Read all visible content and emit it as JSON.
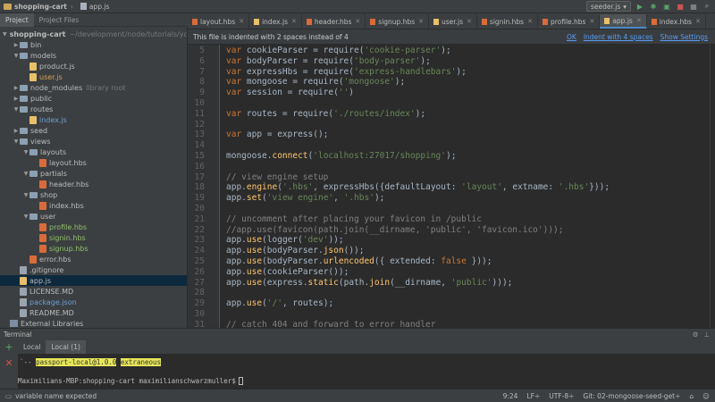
{
  "navbar": {
    "project": "shopping-cart",
    "file": "app.js",
    "run_config": "seeder.js"
  },
  "project_panel": {
    "tabs": [
      "Project",
      "Project Files"
    ],
    "tree": [
      {
        "label": "shopping-cart",
        "suffix": "~/development/node/tutorials/you",
        "indent": 0,
        "type": "folder",
        "expanded": true
      },
      {
        "label": "bin",
        "indent": 1,
        "type": "folder",
        "expanded": false
      },
      {
        "label": "models",
        "indent": 1,
        "type": "folder",
        "expanded": true
      },
      {
        "label": "product.js",
        "indent": 2,
        "type": "js"
      },
      {
        "label": "user.js",
        "indent": 2,
        "type": "js",
        "color": "orange"
      },
      {
        "label": "node_modules",
        "suffix": "library root",
        "indent": 1,
        "type": "folder",
        "expanded": false
      },
      {
        "label": "public",
        "indent": 1,
        "type": "folder",
        "expanded": false
      },
      {
        "label": "routes",
        "indent": 1,
        "type": "folder",
        "expanded": true
      },
      {
        "label": "index.js",
        "indent": 2,
        "type": "js",
        "color": "blue"
      },
      {
        "label": "seed",
        "indent": 1,
        "type": "folder",
        "expanded": false
      },
      {
        "label": "views",
        "indent": 1,
        "type": "folder",
        "expanded": true
      },
      {
        "label": "layouts",
        "indent": 2,
        "type": "folder",
        "expanded": true
      },
      {
        "label": "layout.hbs",
        "indent": 3,
        "type": "hbs"
      },
      {
        "label": "partials",
        "indent": 2,
        "type": "folder",
        "expanded": true
      },
      {
        "label": "header.hbs",
        "indent": 3,
        "type": "hbs"
      },
      {
        "label": "shop",
        "indent": 2,
        "type": "folder",
        "expanded": true
      },
      {
        "label": "index.hbs",
        "indent": 3,
        "type": "hbs"
      },
      {
        "label": "user",
        "indent": 2,
        "type": "folder",
        "expanded": true
      },
      {
        "label": "profile.hbs",
        "indent": 3,
        "type": "hbs",
        "color": "green"
      },
      {
        "label": "signin.hbs",
        "indent": 3,
        "type": "hbs",
        "color": "green"
      },
      {
        "label": "signup.hbs",
        "indent": 3,
        "type": "hbs",
        "color": "green"
      },
      {
        "label": "error.hbs",
        "indent": 2,
        "type": "hbs"
      },
      {
        "label": ".gitignore",
        "indent": 1,
        "type": "txt"
      },
      {
        "label": "app.js",
        "indent": 1,
        "type": "js",
        "selected": true
      },
      {
        "label": "LICENSE.MD",
        "indent": 1,
        "type": "txt"
      },
      {
        "label": "package.json",
        "indent": 1,
        "type": "txt",
        "color": "blue"
      },
      {
        "label": "README.MD",
        "indent": 1,
        "type": "txt"
      },
      {
        "label": "External Libraries",
        "indent": 0,
        "type": "lib"
      }
    ]
  },
  "tabs": [
    {
      "label": "layout.hbs"
    },
    {
      "label": "index.js"
    },
    {
      "label": "header.hbs"
    },
    {
      "label": "signup.hbs"
    },
    {
      "label": "user.js"
    },
    {
      "label": "signin.hbs"
    },
    {
      "label": "profile.hbs"
    },
    {
      "label": "app.js",
      "active": true
    },
    {
      "label": "index.hbs"
    }
  ],
  "banner": {
    "message": "This file is indented with 2 spaces instead of 4",
    "ok": "OK",
    "indent4": "Indent with 4 spaces",
    "settings": "Show Settings"
  },
  "editor": {
    "lines": [
      {
        "n": "5",
        "html": "<span class='kw'>var</span> cookieParser = require(<span class='str'>'cookie-parser'</span>);"
      },
      {
        "n": "6",
        "html": "<span class='kw'>var</span> bodyParser = require(<span class='str'>'body-parser'</span>);"
      },
      {
        "n": "7",
        "html": "<span class='kw'>var</span> expressHbs = require(<span class='str'>'express-handlebars'</span>);"
      },
      {
        "n": "8",
        "html": "<span class='kw'>var</span> mongoose = require(<span class='str'>'mongoose'</span>);"
      },
      {
        "n": "9",
        "html": "<span class='kw'>var</span> session = require(<span class='str'>''</span>)"
      },
      {
        "n": "10",
        "html": ""
      },
      {
        "n": "11",
        "html": "<span class='kw'>var</span> routes = require(<span class='str'>'./routes/index'</span>);"
      },
      {
        "n": "12",
        "html": ""
      },
      {
        "n": "13",
        "html": "<span class='kw'>var</span> app = express();"
      },
      {
        "n": "14",
        "html": ""
      },
      {
        "n": "15",
        "html": "mongoose.<span class='fn'>connect</span>(<span class='str'>'localhost:27017/shopping'</span>);"
      },
      {
        "n": "16",
        "html": ""
      },
      {
        "n": "17",
        "html": "<span class='cmt'>// view engine setup</span>"
      },
      {
        "n": "18",
        "html": "app.<span class='fn'>engine</span>(<span class='str'>'.hbs'</span>, expressHbs({defaultLayout: <span class='str'>'layout'</span>, extname: <span class='str'>'.hbs'</span>}));"
      },
      {
        "n": "19",
        "html": "app.<span class='fn'>set</span>(<span class='str'>'view engine'</span>, <span class='str'>'.hbs'</span>);"
      },
      {
        "n": "20",
        "html": ""
      },
      {
        "n": "21",
        "html": "<span class='cmt'>// uncomment after placing your favicon in /public</span>"
      },
      {
        "n": "22",
        "html": "<span class='cmt'>//app.use(favicon(path.join(__dirname, 'public', 'favicon.ico')));</span>"
      },
      {
        "n": "23",
        "html": "app.<span class='fn'>use</span>(logger(<span class='str'>'dev'</span>));"
      },
      {
        "n": "24",
        "html": "app.<span class='fn'>use</span>(bodyParser.<span class='fn'>json</span>());"
      },
      {
        "n": "25",
        "html": "app.<span class='fn'>use</span>(bodyParser.<span class='fn'>urlencoded</span>({ extended: <span class='kw'>false</span> }));"
      },
      {
        "n": "26",
        "html": "app.<span class='fn'>use</span>(cookieParser());"
      },
      {
        "n": "27",
        "html": "app.<span class='fn'>use</span>(express.<span class='fn'>static</span>(path.<span class='fn'>join</span>(__dirname, <span class='str'>'public'</span>)));"
      },
      {
        "n": "28",
        "html": ""
      },
      {
        "n": "29",
        "html": "app.<span class='fn'>use</span>(<span class='str'>'/'</span>, routes);"
      },
      {
        "n": "30",
        "html": ""
      },
      {
        "n": "31",
        "html": "<span class='cmt'>// catch 404 and forward to error handler</span>"
      }
    ]
  },
  "terminal": {
    "title": "Terminal",
    "tabs": [
      "Local",
      "Local (1)"
    ],
    "output_prefix": "`--",
    "package": "passport-local@1.0.0",
    "tag": "extraneous",
    "prompt": "Maximilians-MBP:shopping-cart maximilianschwarzmuller$"
  },
  "status": {
    "message": "variable name expected",
    "position": "9:24",
    "line_sep": "LF÷",
    "encoding": "UTF-8÷",
    "git": "Git: 02-mongoose-seed-get÷"
  }
}
